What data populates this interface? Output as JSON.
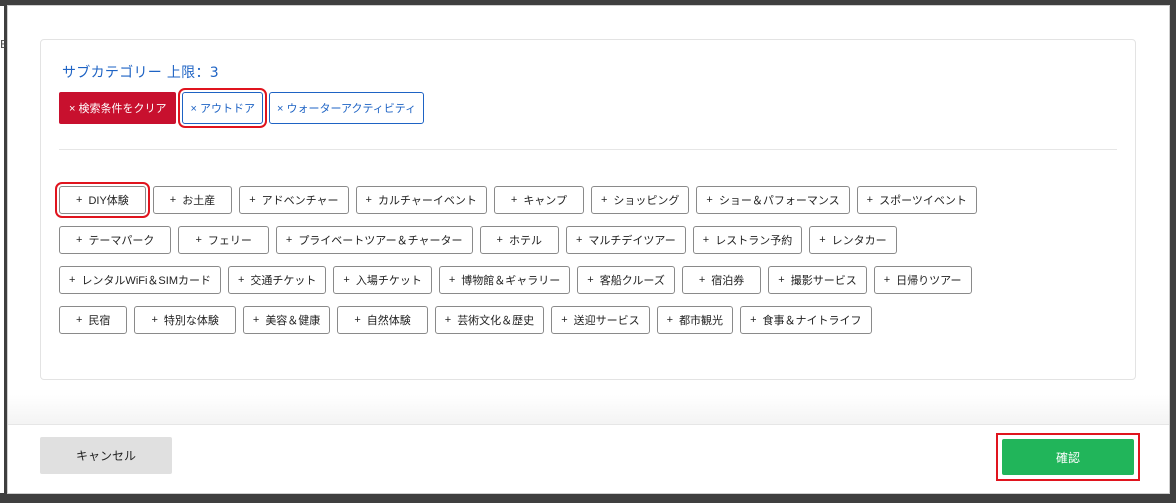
{
  "side_glyph": "B",
  "subcategory": {
    "title": "サブカテゴリー 上限：3"
  },
  "selected": {
    "clear_label": "× 検索条件をクリア",
    "chips": [
      "× アウトドア",
      "× ウォーターアクティビティ"
    ]
  },
  "categories": {
    "rows": [
      [
        "DIY体験",
        "お土産",
        "アドベンチャー",
        "カルチャーイベント",
        "キャンプ",
        "ショッピング",
        "ショー＆パフォーマンス",
        "スポーツイベント"
      ],
      [
        "テーマパーク",
        "フェリー",
        "プライベートツアー＆チャーター",
        "ホテル",
        "マルチデイツアー",
        "レストラン予約",
        "レンタカー"
      ],
      [
        "レンタルWiFi＆SIMカード",
        "交通チケット",
        "入場チケット",
        "博物館＆ギャラリー",
        "客船クルーズ",
        "宿泊券",
        "撮影サービス",
        "日帰りツアー"
      ],
      [
        "民宿",
        "特別な体験",
        "美容＆健康",
        "自然体験",
        "芸術文化＆歴史",
        "送迎サービス",
        "都市観光",
        "食事＆ナイトライフ"
      ]
    ],
    "plus_glyph": "+"
  },
  "footer": {
    "cancel_label": "キャンセル",
    "confirm_label": "確認"
  },
  "colors": {
    "accent_blue": "#1e63c4",
    "clear_red": "#c8102e",
    "confirm_green": "#21b55a",
    "highlight_red": "#e0141e"
  }
}
